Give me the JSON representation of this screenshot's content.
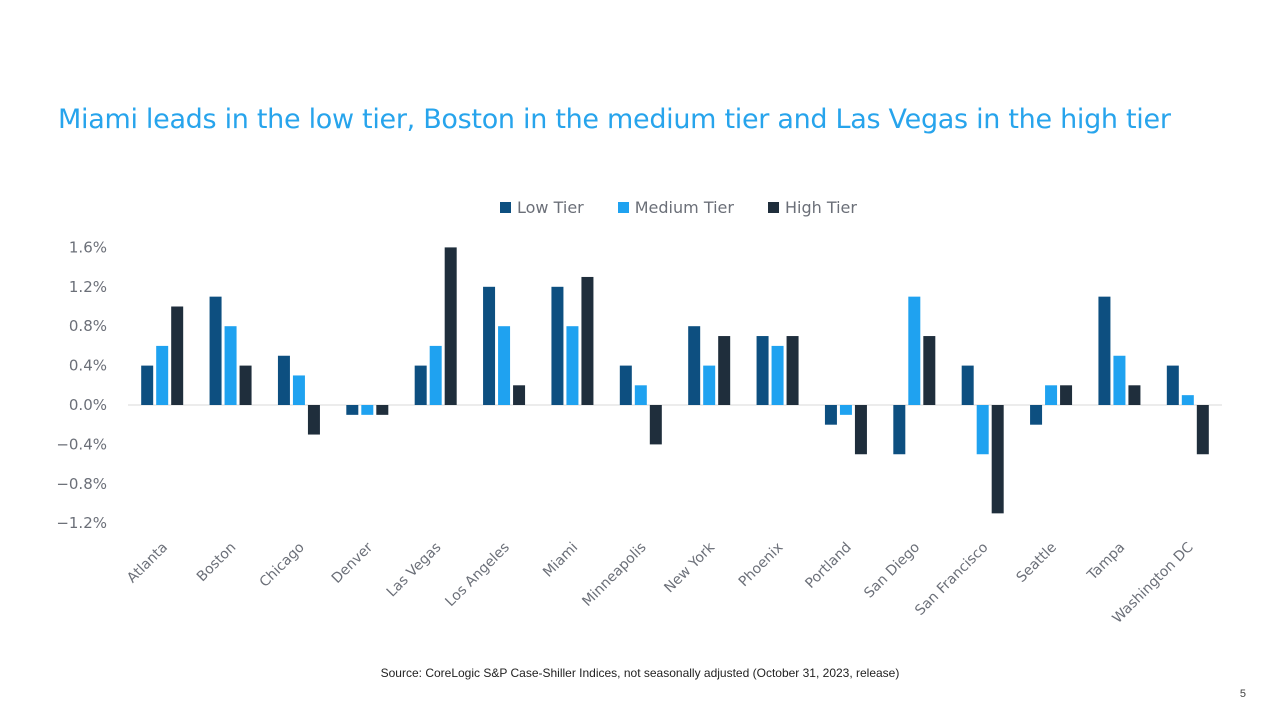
{
  "page": {
    "number": "5",
    "source": "Source: CoreLogic S&P Case-Shiller Indices, not seasonally adjusted (October 31, 2023, release)"
  },
  "chart_data": {
    "type": "bar",
    "title": "Miami leads in the low tier, Boston in the medium tier and Las Vegas in the high tier",
    "xlabel": "",
    "ylabel": "",
    "ylim": [
      -1.2,
      1.6
    ],
    "yticks": [
      1.6,
      1.2,
      0.8,
      0.4,
      0.0,
      -0.4,
      -0.8,
      -1.2
    ],
    "ytick_labels": [
      "1.6%",
      "1.2%",
      "0.8%",
      "0.4%",
      "0.0%",
      "−0.4%",
      "−0.8%",
      "−1.2%"
    ],
    "grid": false,
    "legend_position": "top-center",
    "categories": [
      "Atlanta",
      "Boston",
      "Chicago",
      "Denver",
      "Las Vegas",
      "Los Angeles",
      "Miami",
      "Minneapolis",
      "New York",
      "Phoenix",
      "Portland",
      "San Diego",
      "San Francisco",
      "Seattle",
      "Tampa",
      "Washington DC"
    ],
    "series": [
      {
        "name": "Low Tier",
        "color": "#0d4f80",
        "values": [
          0.4,
          1.1,
          0.5,
          -0.1,
          0.4,
          1.2,
          1.2,
          0.4,
          0.8,
          0.7,
          -0.2,
          -0.5,
          0.4,
          -0.2,
          1.1,
          0.4
        ]
      },
      {
        "name": "Medium Tier",
        "color": "#1fa2f0",
        "values": [
          0.6,
          0.8,
          0.3,
          -0.1,
          0.6,
          0.8,
          0.8,
          0.2,
          0.4,
          0.6,
          -0.1,
          1.1,
          -0.5,
          0.2,
          0.5,
          0.1
        ]
      },
      {
        "name": "High Tier",
        "color": "#1f2e3c",
        "values": [
          1.0,
          0.4,
          -0.3,
          -0.1,
          1.6,
          0.2,
          1.3,
          -0.4,
          0.7,
          0.7,
          -0.5,
          0.7,
          -1.1,
          0.2,
          0.2,
          -0.5
        ]
      }
    ]
  }
}
